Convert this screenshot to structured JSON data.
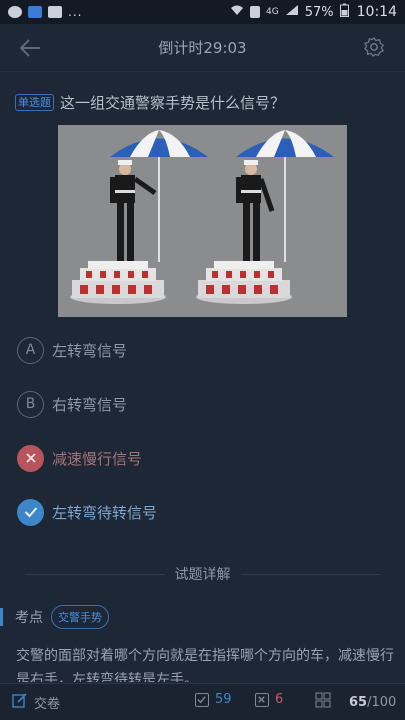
{
  "status_bar": {
    "dots": "...",
    "network": "4G",
    "battery": "57%",
    "time": "10:14"
  },
  "header": {
    "title": "倒计时29:03"
  },
  "question": {
    "type_badge": "单选题",
    "text": "这一组交通警察手势是什么信号？"
  },
  "options": [
    {
      "letter": "A",
      "label": "左转弯信号",
      "state": "normal"
    },
    {
      "letter": "B",
      "label": "右转弯信号",
      "state": "normal"
    },
    {
      "letter": "",
      "label": "减速慢行信号",
      "state": "wrong"
    },
    {
      "letter": "",
      "label": "左转弯待转信号",
      "state": "right"
    }
  ],
  "explanation": {
    "divider_title": "试题详解",
    "point_label": "考点",
    "point_tag": "交警手势",
    "text": "交警的面部对着哪个方向就是在指挥哪个方向的车，减速慢行是右手，左转弯待转是左手。"
  },
  "bottom_bar": {
    "submit_label": "交卷",
    "correct_count": "59",
    "wrong_count": "6",
    "progress_current": "65",
    "progress_total": "/100"
  },
  "colors": {
    "background": "#1e2735",
    "accent_blue": "#3d86c9",
    "wrong_red": "#b7545d"
  }
}
